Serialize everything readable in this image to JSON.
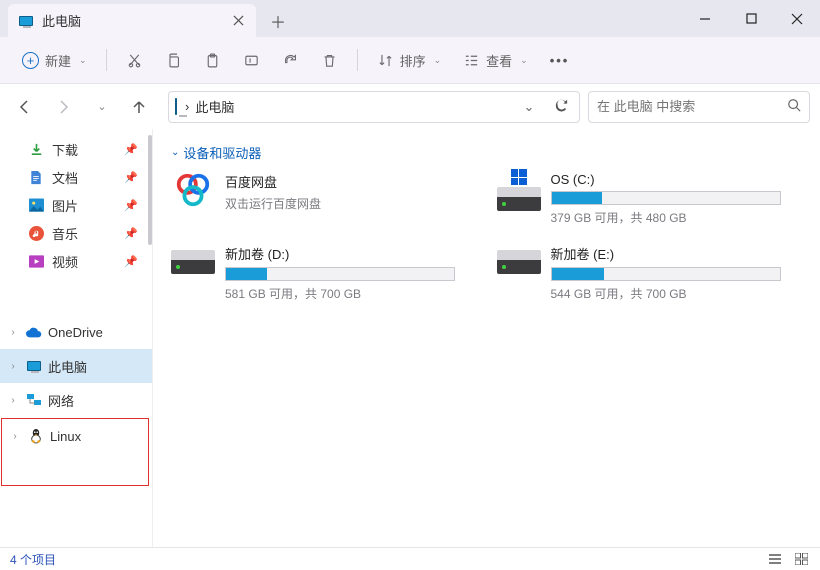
{
  "tab": {
    "title": "此电脑"
  },
  "toolbar": {
    "new_label": "新建",
    "sort_label": "排序",
    "view_label": "查看"
  },
  "breadcrumb": {
    "root": "此电脑",
    "sep": "›"
  },
  "search": {
    "placeholder": "在 此电脑 中搜索"
  },
  "sidebar": {
    "quick": [
      {
        "label": "下载"
      },
      {
        "label": "文档"
      },
      {
        "label": "图片"
      },
      {
        "label": "音乐"
      },
      {
        "label": "视频"
      }
    ],
    "tree": [
      {
        "label": "OneDrive"
      },
      {
        "label": "此电脑"
      },
      {
        "label": "网络"
      },
      {
        "label": "Linux"
      }
    ]
  },
  "section": {
    "title": "设备和驱动器"
  },
  "drives": [
    {
      "title": "百度网盘",
      "sub": "双击运行百度网盘",
      "type": "app"
    },
    {
      "title": "OS (C:)",
      "sub": "379 GB 可用，共 480 GB",
      "type": "os",
      "fill_pct": 22
    },
    {
      "title": "新加卷 (D:)",
      "sub": "581 GB 可用，共 700 GB",
      "type": "hdd",
      "fill_pct": 18
    },
    {
      "title": "新加卷 (E:)",
      "sub": "544 GB 可用，共 700 GB",
      "type": "hdd",
      "fill_pct": 23
    }
  ],
  "status": {
    "count": "4 个项目"
  }
}
